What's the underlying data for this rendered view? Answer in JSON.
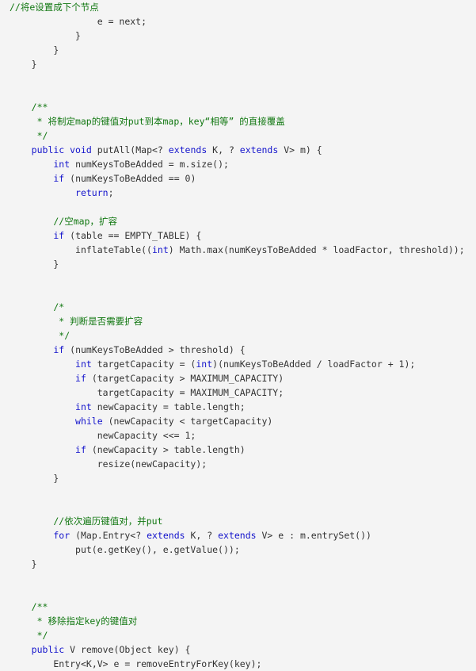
{
  "editor": {
    "language": "java",
    "background_color": "#f4f4f4",
    "default_text_color": "#333333",
    "keyword_color": "#1414cc",
    "comment_color": "#117711",
    "font_size_px": 11.5,
    "line_height_px": 18
  },
  "code": {
    "lines": [
      {
        "indent": 0,
        "segments": [
          {
            "type": "cmt",
            "text": "//将e设置成下个节点"
          }
        ]
      },
      {
        "indent": 16,
        "segments": [
          {
            "type": "plain",
            "text": "e = next;"
          }
        ]
      },
      {
        "indent": 12,
        "segments": [
          {
            "type": "plain",
            "text": "}"
          }
        ]
      },
      {
        "indent": 8,
        "segments": [
          {
            "type": "plain",
            "text": "}"
          }
        ]
      },
      {
        "indent": 4,
        "segments": [
          {
            "type": "plain",
            "text": "}"
          }
        ]
      },
      {
        "indent": 0,
        "segments": [
          {
            "type": "plain",
            "text": ""
          }
        ]
      },
      {
        "indent": 0,
        "segments": [
          {
            "type": "plain",
            "text": ""
          }
        ]
      },
      {
        "indent": 4,
        "segments": [
          {
            "type": "cmt",
            "text": "/**"
          }
        ]
      },
      {
        "indent": 4,
        "segments": [
          {
            "type": "cmt",
            "text": " * 将制定map的键值对put到本map，key“相等” 的直接覆盖"
          }
        ]
      },
      {
        "indent": 4,
        "segments": [
          {
            "type": "cmt",
            "text": " */"
          }
        ]
      },
      {
        "indent": 4,
        "segments": [
          {
            "type": "kw",
            "text": "public void "
          },
          {
            "type": "plain",
            "text": "putAll(Map<? "
          },
          {
            "type": "kw",
            "text": "extends "
          },
          {
            "type": "plain",
            "text": "K, ? "
          },
          {
            "type": "kw",
            "text": "extends "
          },
          {
            "type": "plain",
            "text": "V> m) {"
          }
        ]
      },
      {
        "indent": 8,
        "segments": [
          {
            "type": "kw",
            "text": "int "
          },
          {
            "type": "plain",
            "text": "numKeysToBeAdded = m.size();"
          }
        ]
      },
      {
        "indent": 8,
        "segments": [
          {
            "type": "kw",
            "text": "if "
          },
          {
            "type": "plain",
            "text": "(numKeysToBeAdded == 0)"
          }
        ]
      },
      {
        "indent": 12,
        "segments": [
          {
            "type": "kw",
            "text": "return"
          },
          {
            "type": "plain",
            "text": ";"
          }
        ]
      },
      {
        "indent": 0,
        "segments": [
          {
            "type": "plain",
            "text": ""
          }
        ]
      },
      {
        "indent": 8,
        "segments": [
          {
            "type": "cmt",
            "text": "//空map，扩容"
          }
        ]
      },
      {
        "indent": 8,
        "segments": [
          {
            "type": "kw",
            "text": "if "
          },
          {
            "type": "plain",
            "text": "(table == EMPTY_TABLE) {"
          }
        ]
      },
      {
        "indent": 12,
        "segments": [
          {
            "type": "plain",
            "text": "inflateTable(("
          },
          {
            "type": "kw",
            "text": "int"
          },
          {
            "type": "plain",
            "text": ") Math.max(numKeysToBeAdded * loadFactor, threshold));"
          }
        ]
      },
      {
        "indent": 8,
        "segments": [
          {
            "type": "plain",
            "text": "}"
          }
        ]
      },
      {
        "indent": 0,
        "segments": [
          {
            "type": "plain",
            "text": ""
          }
        ]
      },
      {
        "indent": 0,
        "segments": [
          {
            "type": "plain",
            "text": ""
          }
        ]
      },
      {
        "indent": 8,
        "segments": [
          {
            "type": "cmt",
            "text": "/*"
          }
        ]
      },
      {
        "indent": 8,
        "segments": [
          {
            "type": "cmt",
            "text": " * 判断是否需要扩容"
          }
        ]
      },
      {
        "indent": 8,
        "segments": [
          {
            "type": "cmt",
            "text": " */"
          }
        ]
      },
      {
        "indent": 8,
        "segments": [
          {
            "type": "kw",
            "text": "if "
          },
          {
            "type": "plain",
            "text": "(numKeysToBeAdded > threshold) {"
          }
        ]
      },
      {
        "indent": 12,
        "segments": [
          {
            "type": "kw",
            "text": "int "
          },
          {
            "type": "plain",
            "text": "targetCapacity = ("
          },
          {
            "type": "kw",
            "text": "int"
          },
          {
            "type": "plain",
            "text": ")(numKeysToBeAdded / loadFactor + 1);"
          }
        ]
      },
      {
        "indent": 12,
        "segments": [
          {
            "type": "kw",
            "text": "if "
          },
          {
            "type": "plain",
            "text": "(targetCapacity > MAXIMUM_CAPACITY)"
          }
        ]
      },
      {
        "indent": 16,
        "segments": [
          {
            "type": "plain",
            "text": "targetCapacity = MAXIMUM_CAPACITY;"
          }
        ]
      },
      {
        "indent": 12,
        "segments": [
          {
            "type": "kw",
            "text": "int "
          },
          {
            "type": "plain",
            "text": "newCapacity = table.length;"
          }
        ]
      },
      {
        "indent": 12,
        "segments": [
          {
            "type": "kw",
            "text": "while "
          },
          {
            "type": "plain",
            "text": "(newCapacity < targetCapacity)"
          }
        ]
      },
      {
        "indent": 16,
        "segments": [
          {
            "type": "plain",
            "text": "newCapacity <<= 1;"
          }
        ]
      },
      {
        "indent": 12,
        "segments": [
          {
            "type": "kw",
            "text": "if "
          },
          {
            "type": "plain",
            "text": "(newCapacity > table.length)"
          }
        ]
      },
      {
        "indent": 16,
        "segments": [
          {
            "type": "plain",
            "text": "resize(newCapacity);"
          }
        ]
      },
      {
        "indent": 8,
        "segments": [
          {
            "type": "plain",
            "text": "}"
          }
        ]
      },
      {
        "indent": 0,
        "segments": [
          {
            "type": "plain",
            "text": ""
          }
        ]
      },
      {
        "indent": 0,
        "segments": [
          {
            "type": "plain",
            "text": ""
          }
        ]
      },
      {
        "indent": 8,
        "segments": [
          {
            "type": "cmt",
            "text": "//依次遍历键值对，并put"
          }
        ]
      },
      {
        "indent": 8,
        "segments": [
          {
            "type": "kw",
            "text": "for "
          },
          {
            "type": "plain",
            "text": "(Map.Entry<? "
          },
          {
            "type": "kw",
            "text": "extends "
          },
          {
            "type": "plain",
            "text": "K, ? "
          },
          {
            "type": "kw",
            "text": "extends "
          },
          {
            "type": "plain",
            "text": "V> e : m.entrySet())"
          }
        ]
      },
      {
        "indent": 12,
        "segments": [
          {
            "type": "plain",
            "text": "put(e.getKey(), e.getValue());"
          }
        ]
      },
      {
        "indent": 4,
        "segments": [
          {
            "type": "plain",
            "text": "}"
          }
        ]
      },
      {
        "indent": 0,
        "segments": [
          {
            "type": "plain",
            "text": ""
          }
        ]
      },
      {
        "indent": 0,
        "segments": [
          {
            "type": "plain",
            "text": ""
          }
        ]
      },
      {
        "indent": 4,
        "segments": [
          {
            "type": "cmt",
            "text": "/**"
          }
        ]
      },
      {
        "indent": 4,
        "segments": [
          {
            "type": "cmt",
            "text": " * 移除指定key的键值对"
          }
        ]
      },
      {
        "indent": 4,
        "segments": [
          {
            "type": "cmt",
            "text": " */"
          }
        ]
      },
      {
        "indent": 4,
        "segments": [
          {
            "type": "kw",
            "text": "public "
          },
          {
            "type": "plain",
            "text": "V remove(Object key) {"
          }
        ]
      },
      {
        "indent": 8,
        "segments": [
          {
            "type": "plain",
            "text": "Entry<K,V> e = removeEntryForKey(key);"
          }
        ]
      }
    ]
  }
}
